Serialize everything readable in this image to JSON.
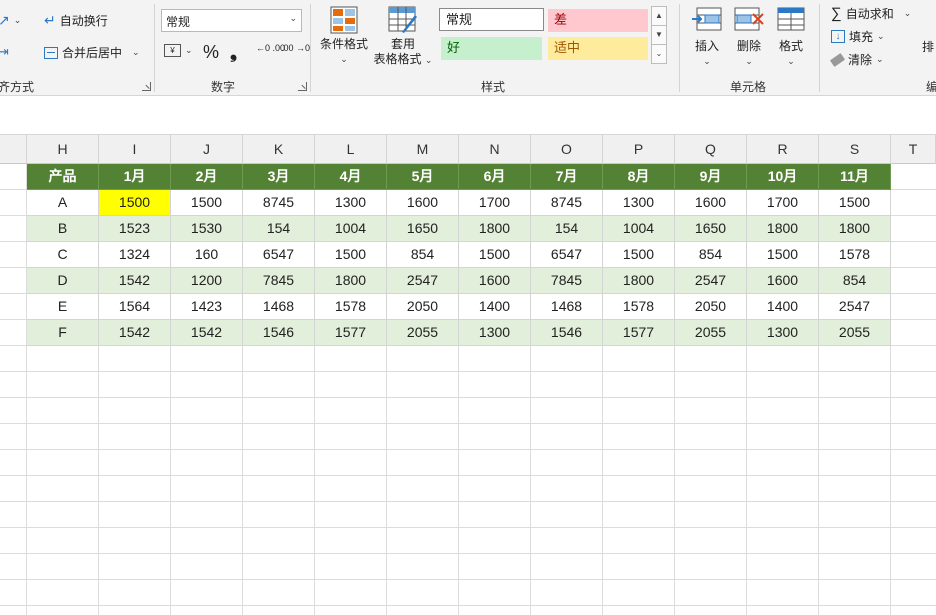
{
  "ribbon": {
    "alignment": {
      "wrap_text": "自动换行",
      "merge_center": "合并后居中",
      "group_label": "对齐方式"
    },
    "number": {
      "format_value": "常规",
      "percent_symbol": "%",
      "comma_symbol": "❟",
      "increase_decimal": "←0 .00",
      "decrease_decimal": ".00 →0",
      "group_label": "数字"
    },
    "styles": {
      "conditional_format_label": "条件格式",
      "table_format_line1": "套用",
      "table_format_line2": "表格格式",
      "style_normal": "常规",
      "style_bad": "差",
      "style_good": "好",
      "style_neutral": "适中",
      "group_label": "样式",
      "colors": {
        "normal_bg": "#ffffff",
        "bad_bg": "#ffc7ce",
        "bad_fg": "#9c0006",
        "good_bg": "#c6efce",
        "good_fg": "#006100",
        "neutral_bg": "#ffeb9c",
        "neutral_fg": "#9c5700"
      }
    },
    "cells": {
      "insert_label": "插入",
      "delete_label": "删除",
      "format_label": "格式",
      "group_label": "单元格"
    },
    "editing": {
      "autosum_label": "自动求和",
      "fill_label": "填充",
      "clear_label": "清除",
      "sort_label_partial": "排",
      "group_label_partial": "编"
    }
  },
  "sheet": {
    "columns": [
      "H",
      "I",
      "J",
      "K",
      "L",
      "M",
      "N",
      "O",
      "P",
      "Q",
      "R",
      "S",
      "T"
    ],
    "header_row": [
      "产品",
      "1月",
      "2月",
      "3月",
      "4月",
      "5月",
      "6月",
      "7月",
      "8月",
      "9月",
      "10月",
      "11月"
    ],
    "rows": [
      [
        "A",
        "1500",
        "1500",
        "8745",
        "1300",
        "1600",
        "1700",
        "8745",
        "1300",
        "1600",
        "1700",
        "1500"
      ],
      [
        "B",
        "1523",
        "1530",
        "154",
        "1004",
        "1650",
        "1800",
        "154",
        "1004",
        "1650",
        "1800",
        "1800"
      ],
      [
        "C",
        "1324",
        "160",
        "6547",
        "1500",
        "854",
        "1500",
        "6547",
        "1500",
        "854",
        "1500",
        "1578"
      ],
      [
        "D",
        "1542",
        "1200",
        "7845",
        "1800",
        "2547",
        "1600",
        "7845",
        "1800",
        "2547",
        "1600",
        "854"
      ],
      [
        "E",
        "1564",
        "1423",
        "1468",
        "1578",
        "2050",
        "1400",
        "1468",
        "1578",
        "2050",
        "1400",
        "2547"
      ],
      [
        "F",
        "1542",
        "1542",
        "1546",
        "1577",
        "2055",
        "1300",
        "1546",
        "1577",
        "2055",
        "1300",
        "2055"
      ]
    ],
    "colors": {
      "header_bg": "#548235",
      "band_bg": "#e2efda",
      "highlight_bg": "#ffff00"
    }
  }
}
